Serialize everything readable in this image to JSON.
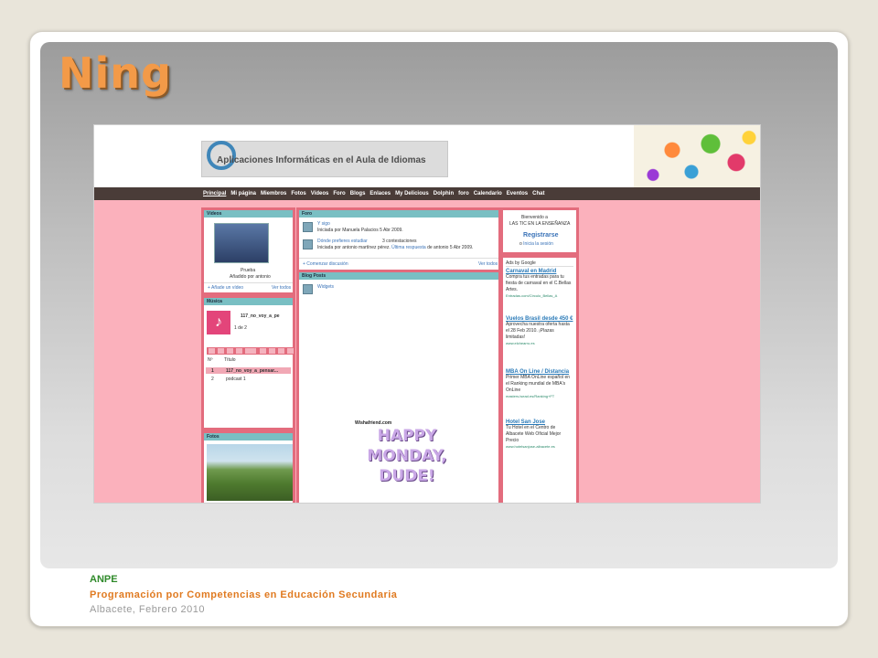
{
  "slide": {
    "title": "Ning"
  },
  "ning": {
    "logo_text": "Aplicaciones Informáticas en el Aula de Idiomas",
    "nav": [
      "Principal",
      "Mi página",
      "Miembros",
      "Fotos",
      "Vídeos",
      "Foro",
      "Blogs",
      "Enlaces",
      "My Delicious",
      "Dolphin",
      "foro",
      "Calendario",
      "Eventos",
      "Chat"
    ],
    "videos": {
      "header": "Vídeos",
      "video_title": "Prueba",
      "added_by": "Añadido por antonio",
      "add_link": "+ Añade un vídeo",
      "see_all": "Ver todos"
    },
    "music": {
      "header": "Música",
      "track_name": "117_no_voy_a_pe",
      "track_count": "1 de 2",
      "col_num": "Nº",
      "col_title": "Título",
      "rows": [
        {
          "num": "1",
          "title": "117_no_voy_a_pensar..."
        },
        {
          "num": "2",
          "title": "podcast 1"
        }
      ]
    },
    "photos": {
      "header": "Fotos"
    },
    "forum": {
      "header": "Foro",
      "items": [
        {
          "title": "Y sigo",
          "meta": "Iniciada por Manuela Palacios 5 Abr 2009."
        },
        {
          "title": "Dónde prefieres estudiar",
          "replies": "3 contestaciones",
          "meta_prefix": "Iniciada por antonio martínez pérez.",
          "meta_link": "Última respuesta",
          "meta_suffix": "de antonio 5 Abr 2009."
        }
      ],
      "start_link": "+ Comenzar discusión",
      "see_all": "Ver todos"
    },
    "blog": {
      "header": "Blog Posts",
      "items": [
        {
          "title": "Widgets"
        }
      ],
      "image_caption": "Wishafriend.com",
      "image_lines": [
        "HAPPY",
        "MONDAY,",
        "DUDE!"
      ]
    },
    "welcome": {
      "line1": "Bienvenido a",
      "line2": "LAS TIC EN LA ENSEÑANZA",
      "register": "Registrarse",
      "or_login_prefix": "o",
      "login": "Inicia la sesión"
    },
    "ads": {
      "label": "Ads by Google",
      "items": [
        {
          "title": "Carnaval en Madrid",
          "body": "Compra tus entradas para tu fiesta de carnaval en el C.Bellas Artes.",
          "url": "Entradas.com/Circulo_Bellas_A"
        },
        {
          "title": "Vuelos Brasil desde 450 €",
          "body": "Aprovecha nuestra oferta hasta el 28 Feb 2010. ¡Plazas limitadas!",
          "url": "www.elchearro.es"
        },
        {
          "title": "MBA On Line / Distancia",
          "body": "Primer MBA OnLine español en el Ranking mundial de MBA's OnLine",
          "url": "masters.isead.es/Ranking+FT"
        },
        {
          "title": "Hotel San Jose",
          "body": "Tu Hotel en el Centro de Albacete Web Oficial Mejor Precio",
          "url": "www.hotelsanjose-albacete.es"
        }
      ]
    }
  },
  "footer": {
    "org": "ANPE",
    "course": "Programación por Competencias en Educación Secundaria",
    "place_date": "Albacete, Febrero 2010"
  },
  "colors": {
    "title_orange": "#f39a48",
    "ning_pink": "#fbb1bc",
    "ning_nav": "#4a3c38",
    "box_header_teal": "#79bfc3",
    "footer_green": "#2f8a2a",
    "footer_orange": "#e07a20"
  }
}
